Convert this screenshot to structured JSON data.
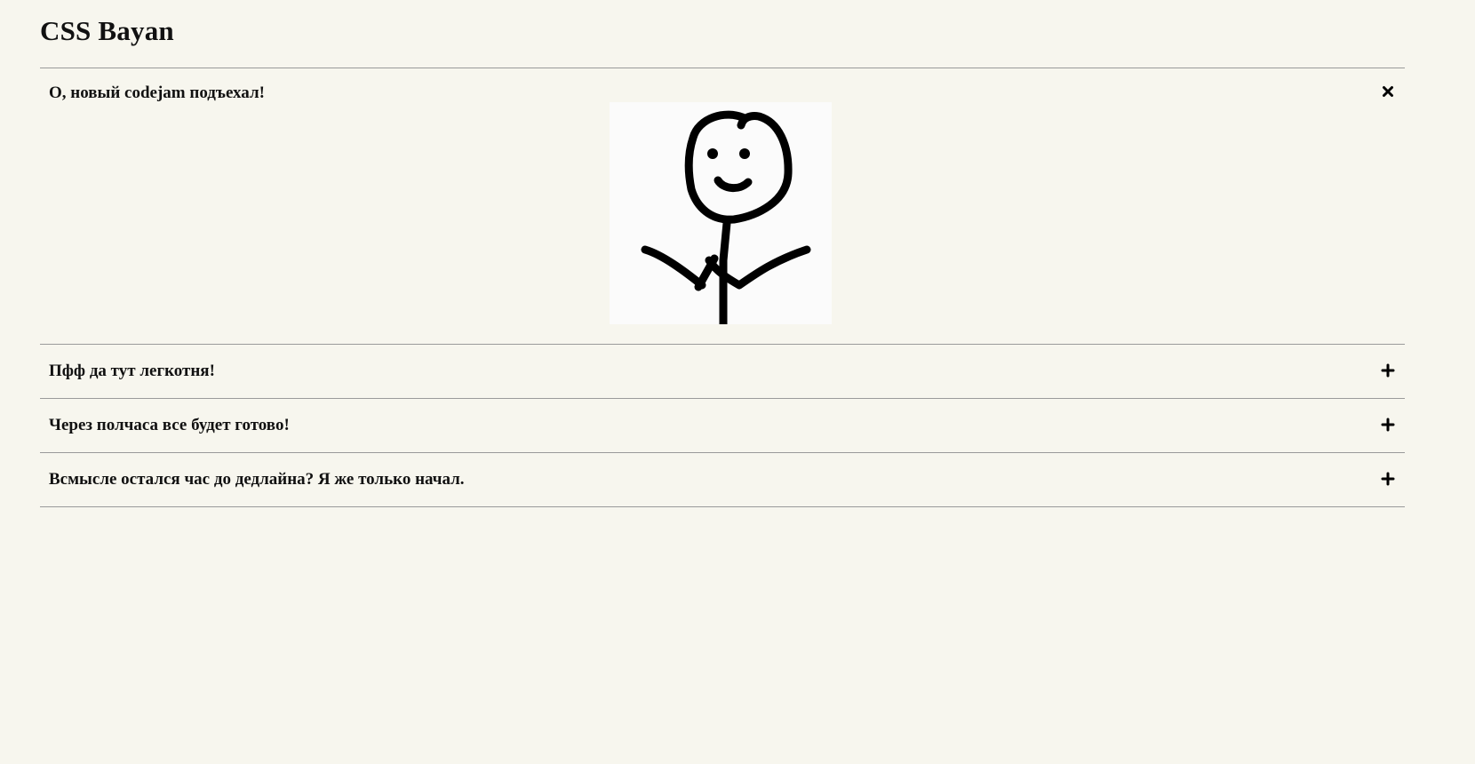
{
  "page": {
    "title": "CSS Bayan"
  },
  "accordion": {
    "items": [
      {
        "title": "О, новый codejam подъехал!",
        "state": "open",
        "toggle_icon": "close-icon"
      },
      {
        "title": "Пфф да тут легкотня!",
        "state": "closed",
        "toggle_icon": "plus-icon"
      },
      {
        "title": "Через полчаса все будет готово!",
        "state": "closed",
        "toggle_icon": "plus-icon"
      },
      {
        "title": "Всмысле остался час до дедлайна? Я же только начал.",
        "state": "closed",
        "toggle_icon": "plus-icon"
      }
    ],
    "open_panel_image": "stick-figure-meme"
  },
  "colors": {
    "background": "#f7f6ee",
    "divider": "#9a9a9a",
    "text": "#111111"
  }
}
